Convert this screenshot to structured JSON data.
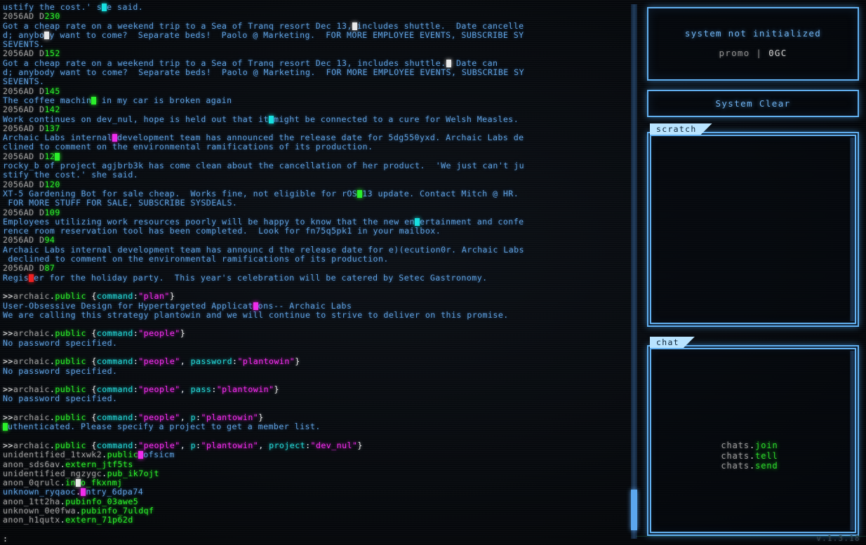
{
  "terminal": {
    "lines": [
      {
        "t": "body",
        "text": "ustify the cost.' s",
        "glitch": "cy",
        "after": "e said."
      },
      {
        "t": "stamp",
        "pre": "2056AD D",
        "num": "230"
      },
      {
        "t": "body",
        "text": "Got a cheap rate on a weekend trip to a Sea of Tranq resort Dec 13,",
        "glitch": "wh",
        "after": "includes shuttle.  Date cancelle"
      },
      {
        "t": "body",
        "text": "d; anybo",
        "glitch": "wh",
        "after": "y want to come?  Separate beds!  Paolo @ Marketing.  FOR MORE EMPLOYEE EVENTS, SUBSCRIBE SY"
      },
      {
        "t": "body",
        "text": "SEVENTS."
      },
      {
        "t": "stamp",
        "pre": "2056AD D",
        "num": "152"
      },
      {
        "t": "body",
        "text": "Got a cheap rate on a weekend trip to a Sea of Tranq resort Dec 13, includes shuttle.",
        "glitch": "wh",
        "after": " Date can"
      },
      {
        "t": "body",
        "text": "d; anybody want to come?  Separate beds!  Paolo @ Marketing.  FOR MORE EMPLOYEE EVENTS, SUBSCRIBE SY"
      },
      {
        "t": "body",
        "text": "SEVENTS."
      },
      {
        "t": "stamp",
        "pre": "2056AD D",
        "num": "145"
      },
      {
        "t": "body",
        "text": "The coffee machin",
        "glitch": "gr",
        "after": " in my car is broken again"
      },
      {
        "t": "stamp",
        "pre": "2056AD D",
        "num": "142"
      },
      {
        "t": "body",
        "text": "Work continues on dev_nul, hope is held out that it",
        "glitch": "cy",
        "after": "might be connected to a cure for Welsh Measles."
      },
      {
        "t": "stamp",
        "pre": "2056AD D",
        "num": "137"
      },
      {
        "t": "body",
        "text": "Archaic Labs internal",
        "glitch": "mg",
        "after": "development team has announced the release date for 5dg550yxd. Archaic Labs de"
      },
      {
        "t": "body",
        "text": "clined to comment on the environmental ramifications of its production."
      },
      {
        "t": "stamp",
        "pre": "2056AD D",
        "num": "12",
        "glitch": "gr"
      },
      {
        "t": "body",
        "text": "rocky_b of project agjbrb3k has come clean about the cancellation of her product.  'We just can't ju"
      },
      {
        "t": "body",
        "text": "stify the cost.' she said."
      },
      {
        "t": "stamp",
        "pre": "2056AD D",
        "num": "120"
      },
      {
        "t": "body",
        "text": "XT-5 Gardening Bot for sale cheap.  Works fine, not eligible for rOS",
        "glitch": "gr",
        "after": "13 update. Contact Mitch @ HR."
      },
      {
        "t": "body",
        "text": " FOR MORE STUFF FOR SALE, SUBSCRIBE SYSDEALS."
      },
      {
        "t": "stamp",
        "pre": "2056AD D",
        "num": "109"
      },
      {
        "t": "body",
        "text": "Employees utilizing work resources poorly will be happy to know that the new en",
        "glitch": "cy",
        "after": "ertainment and confe"
      },
      {
        "t": "body",
        "text": "rence room reservation tool has been completed.  Look for fn75q5pk1 in your mailbox."
      },
      {
        "t": "stamp",
        "pre": "2056AD D",
        "num": "94"
      },
      {
        "t": "body",
        "text": "Archaic Labs internal development team has announc d the release date for e)(ecution0r. Archaic Labs"
      },
      {
        "t": "body",
        "text": " declined to comment on the environmental ramifications of its production."
      },
      {
        "t": "stamp",
        "pre": "2056AD D",
        "num": "87"
      },
      {
        "t": "body",
        "text": "Regis",
        "glitch": "rd",
        "after": "er for the holiday party.  This year's celebration will be catered by Setec Gastronomy."
      },
      {
        "t": "blank"
      },
      {
        "t": "cmd",
        "host": "archaic",
        "pub": "public",
        "args": [
          {
            "key": "command",
            "val": "plan"
          }
        ]
      },
      {
        "t": "body",
        "text": "User-Obsessive Design for Hypertargeted Applicat",
        "glitch": "mg",
        "after": "ons-- Archaic Labs"
      },
      {
        "t": "body",
        "text": "We are calling this strategy plantowin and we will continue to strive to deliver on this promise."
      },
      {
        "t": "blank"
      },
      {
        "t": "cmd",
        "host": "archaic",
        "pub": "public",
        "args": [
          {
            "key": "command",
            "val": "people"
          }
        ]
      },
      {
        "t": "body",
        "text": "No password specified."
      },
      {
        "t": "blank"
      },
      {
        "t": "cmd",
        "host": "archaic",
        "pub": "public",
        "args": [
          {
            "key": "command",
            "val": "people"
          },
          {
            "key": "password",
            "val": "plantowin"
          }
        ]
      },
      {
        "t": "body",
        "text": "No password specified."
      },
      {
        "t": "blank"
      },
      {
        "t": "cmd",
        "host": "archaic",
        "pub": "public",
        "args": [
          {
            "key": "command",
            "val": "people"
          },
          {
            "key": "pass",
            "val": "plantowin"
          }
        ]
      },
      {
        "t": "body",
        "text": "No password specified."
      },
      {
        "t": "blank"
      },
      {
        "t": "cmd",
        "host": "archaic",
        "pub": "public",
        "args": [
          {
            "key": "command",
            "val": "people"
          },
          {
            "key": "p",
            "val": "plantowin"
          }
        ]
      },
      {
        "t": "body",
        "text": "",
        "glitch": "gr",
        "after": "uthenticated. Please specify a project to get a member list."
      },
      {
        "t": "blank"
      },
      {
        "t": "cmd",
        "host": "archaic",
        "pub": "public",
        "args": [
          {
            "key": "command",
            "val": "people"
          },
          {
            "key": "p",
            "val": "plantowin"
          },
          {
            "key": "project",
            "val": "dev_nul"
          }
        ]
      },
      {
        "t": "member",
        "user": "unidentified_1txwk2",
        "dom": "public",
        "glitch": "mg",
        "after": "ofsicm",
        "domblue": false,
        "afterblue": true
      },
      {
        "t": "member",
        "user": "anon_sds6av",
        "dom": "extern_jtf5ts"
      },
      {
        "t": "member",
        "user": "unidentified_ngzygc",
        "dom": "pub_ik7ojt"
      },
      {
        "t": "member",
        "user": "anon_0qrulc",
        "dom": "in",
        "glitch": "wh",
        "after": "o_fkxnmj"
      },
      {
        "t": "member",
        "user": "unknown_ryqaoc",
        "dom": "",
        "glitch": "mg",
        "after": "ntry_6dpa74",
        "userblue": true,
        "afterblue": true
      },
      {
        "t": "member",
        "user": "anon_1tt2ha",
        "dom": "pubinfo_03awe5"
      },
      {
        "t": "member",
        "user": "unknown_0e0fwa",
        "dom": "pubinfo_7uldqf"
      },
      {
        "t": "member",
        "user": "anon_h1qutx",
        "dom": "extern_71p62d"
      },
      {
        "t": "blank"
      },
      {
        "t": "prompt",
        "text": ":"
      }
    ]
  },
  "sidebar": {
    "status": {
      "line1": "system not initialized",
      "promo_label": "promo  |  ",
      "promo_value": "0GC"
    },
    "system_clear_label": "System Clear",
    "scratch": {
      "title": "scratch",
      "content": ""
    },
    "chat": {
      "title": "chat",
      "commands": [
        {
          "obj": "chats",
          "fn": "join"
        },
        {
          "obj": "chats",
          "fn": "tell"
        },
        {
          "obj": "chats",
          "fn": "send"
        }
      ]
    },
    "version": "v.1.3.18"
  },
  "colors": {
    "accent_blue": "#62b0f0",
    "body_text": "#5e9fdd",
    "green": "#2bf02b",
    "cyan": "#24d6d6",
    "magenta": "#f22ced",
    "gray": "#9a9a9a"
  }
}
